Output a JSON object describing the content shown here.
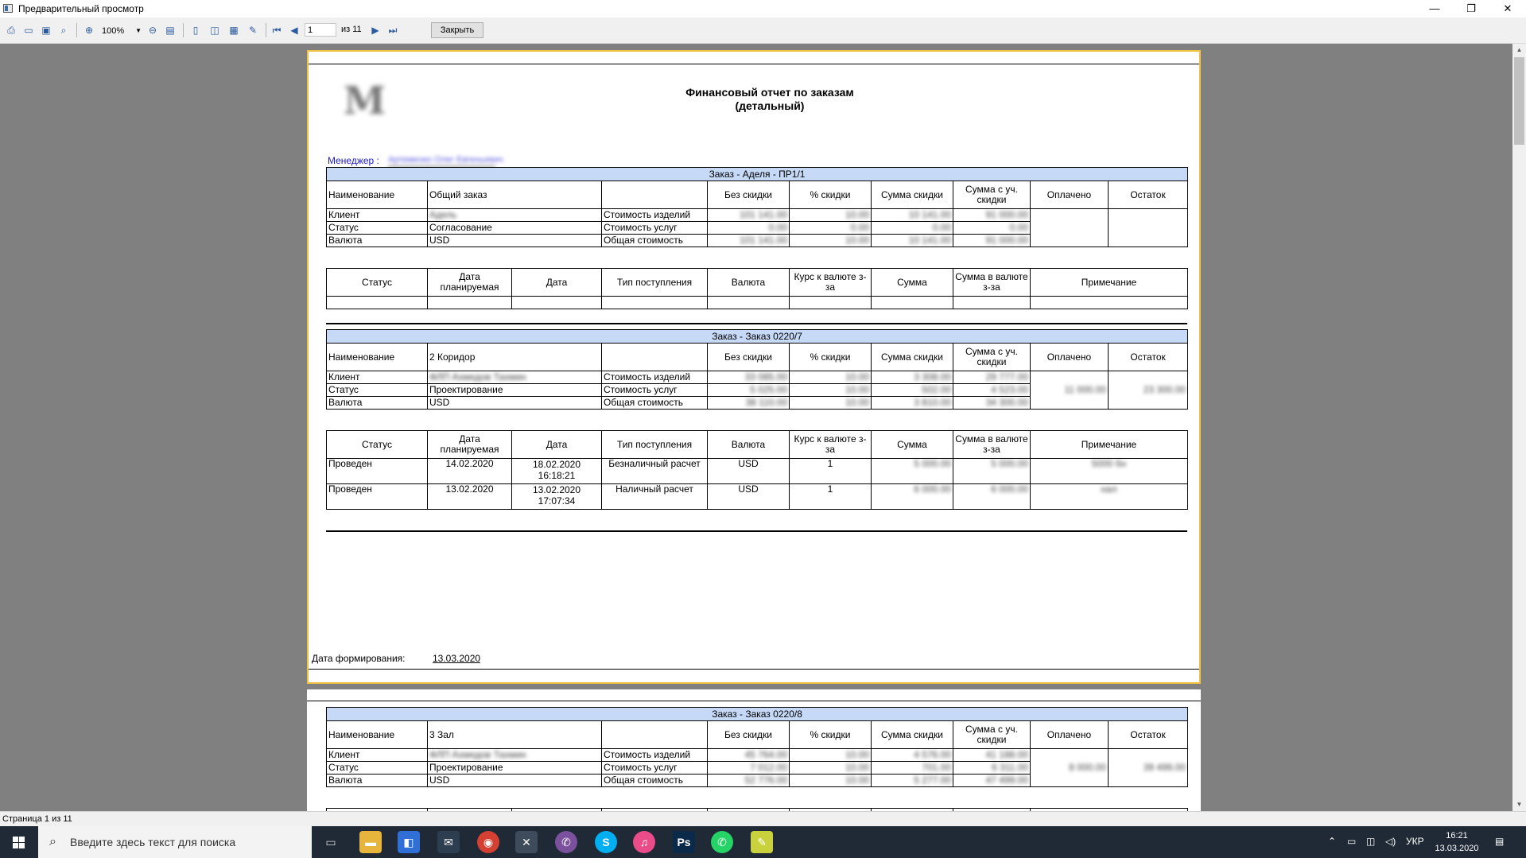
{
  "window": {
    "title": "Предварительный просмотр",
    "minimize": "—",
    "restore": "❐",
    "close": "✕"
  },
  "toolbar": {
    "zoom": "100%",
    "page_current": "1",
    "page_of": "из 11",
    "close_label": "Закрыть"
  },
  "report": {
    "title_line1": "Финансовый отчет по заказам",
    "title_line2": "(детальный)",
    "manager_label": "Менеджер :",
    "manager_value": "Артеменко Олег Евгеньевич",
    "date_label": "Дата формирования:",
    "date_value": "13.03.2020"
  },
  "order_headers": [
    "Наименование",
    "",
    "",
    "Без скидки",
    "% скидки",
    "Сумма скидки",
    "Сумма с уч. скидки",
    "Оплачено",
    "Остаток"
  ],
  "row_labels": {
    "client": "Клиент",
    "status": "Статус",
    "currency": "Валюта"
  },
  "cost_labels": {
    "products": "Стоимость изделий",
    "services": "Стоимость услуг",
    "total": "Общая стоимость"
  },
  "payment_headers": [
    "Статус",
    "Дата планируемая",
    "Дата",
    "Тип поступления",
    "Валюта",
    "Курс к валюте з-за",
    "Сумма",
    "Сумма в валюте з-за",
    "Примечание"
  ],
  "orders": [
    {
      "band": "Заказ - Аделя - ПР1/1",
      "name": "Общий заказ",
      "client": "Адель",
      "status": "Согласование",
      "currency": "USD",
      "rows": [
        [
          "101 141.00",
          "10.00",
          "10 141.00",
          "91 000.00"
        ],
        [
          "0.00",
          "0.00",
          "0.00",
          "0.00"
        ],
        [
          "101 141.00",
          "10.00",
          "10 141.00",
          "91 000.00"
        ]
      ],
      "paid": "",
      "rest": "",
      "payments": []
    },
    {
      "band": "Заказ - Заказ 0220/7",
      "name": "2 Коридор",
      "client": "ФЛП Ахмедов Тахмин",
      "status": "Проектирование",
      "currency": "USD",
      "rows": [
        [
          "33 085.00",
          "10.00",
          "3 308.00",
          "29 777.00"
        ],
        [
          "5 025.00",
          "10.00",
          "502.00",
          "4 523.00"
        ],
        [
          "38 110.00",
          "10.00",
          "3 810.00",
          "34 300.00"
        ]
      ],
      "paid": "11 000.00",
      "rest": "23 300.00",
      "payments": [
        {
          "status": "Проведен",
          "planned": "14.02.2020",
          "date1": "18.02.2020",
          "date2": "16:18:21",
          "type": "Безналичный расчет",
          "currency": "USD",
          "rate": "1",
          "sum": "5 000.00",
          "sum_cur": "5 000.00",
          "note": "5000 бн"
        },
        {
          "status": "Проведен",
          "planned": "13.02.2020",
          "date1": "13.02.2020",
          "date2": "17:07:34",
          "type": "Наличный расчет",
          "currency": "USD",
          "rate": "1",
          "sum": "6 000.00",
          "sum_cur": "6 000.00",
          "note": "нал"
        }
      ]
    },
    {
      "band": "Заказ - Заказ 0220/8",
      "name": "3 Зал",
      "client": "ФЛП Ахмедов Тахмин",
      "status": "Проектирование",
      "currency": "USD",
      "rows": [
        [
          "45 764.00",
          "10.00",
          "4 576.00",
          "41 188.00"
        ],
        [
          "7 012.00",
          "10.00",
          "701.00",
          "6 311.00"
        ],
        [
          "52 776.00",
          "10.00",
          "5 277.00",
          "47 499.00"
        ]
      ],
      "paid": "8 000.00",
      "rest": "39 499.00"
    }
  ],
  "statusbar": {
    "text": "Страница 1 из 11"
  },
  "taskbar": {
    "search_placeholder": "Введите здесь текст для поиска",
    "lang": "УКР",
    "time": "16:21",
    "date": "13.03.2020"
  }
}
